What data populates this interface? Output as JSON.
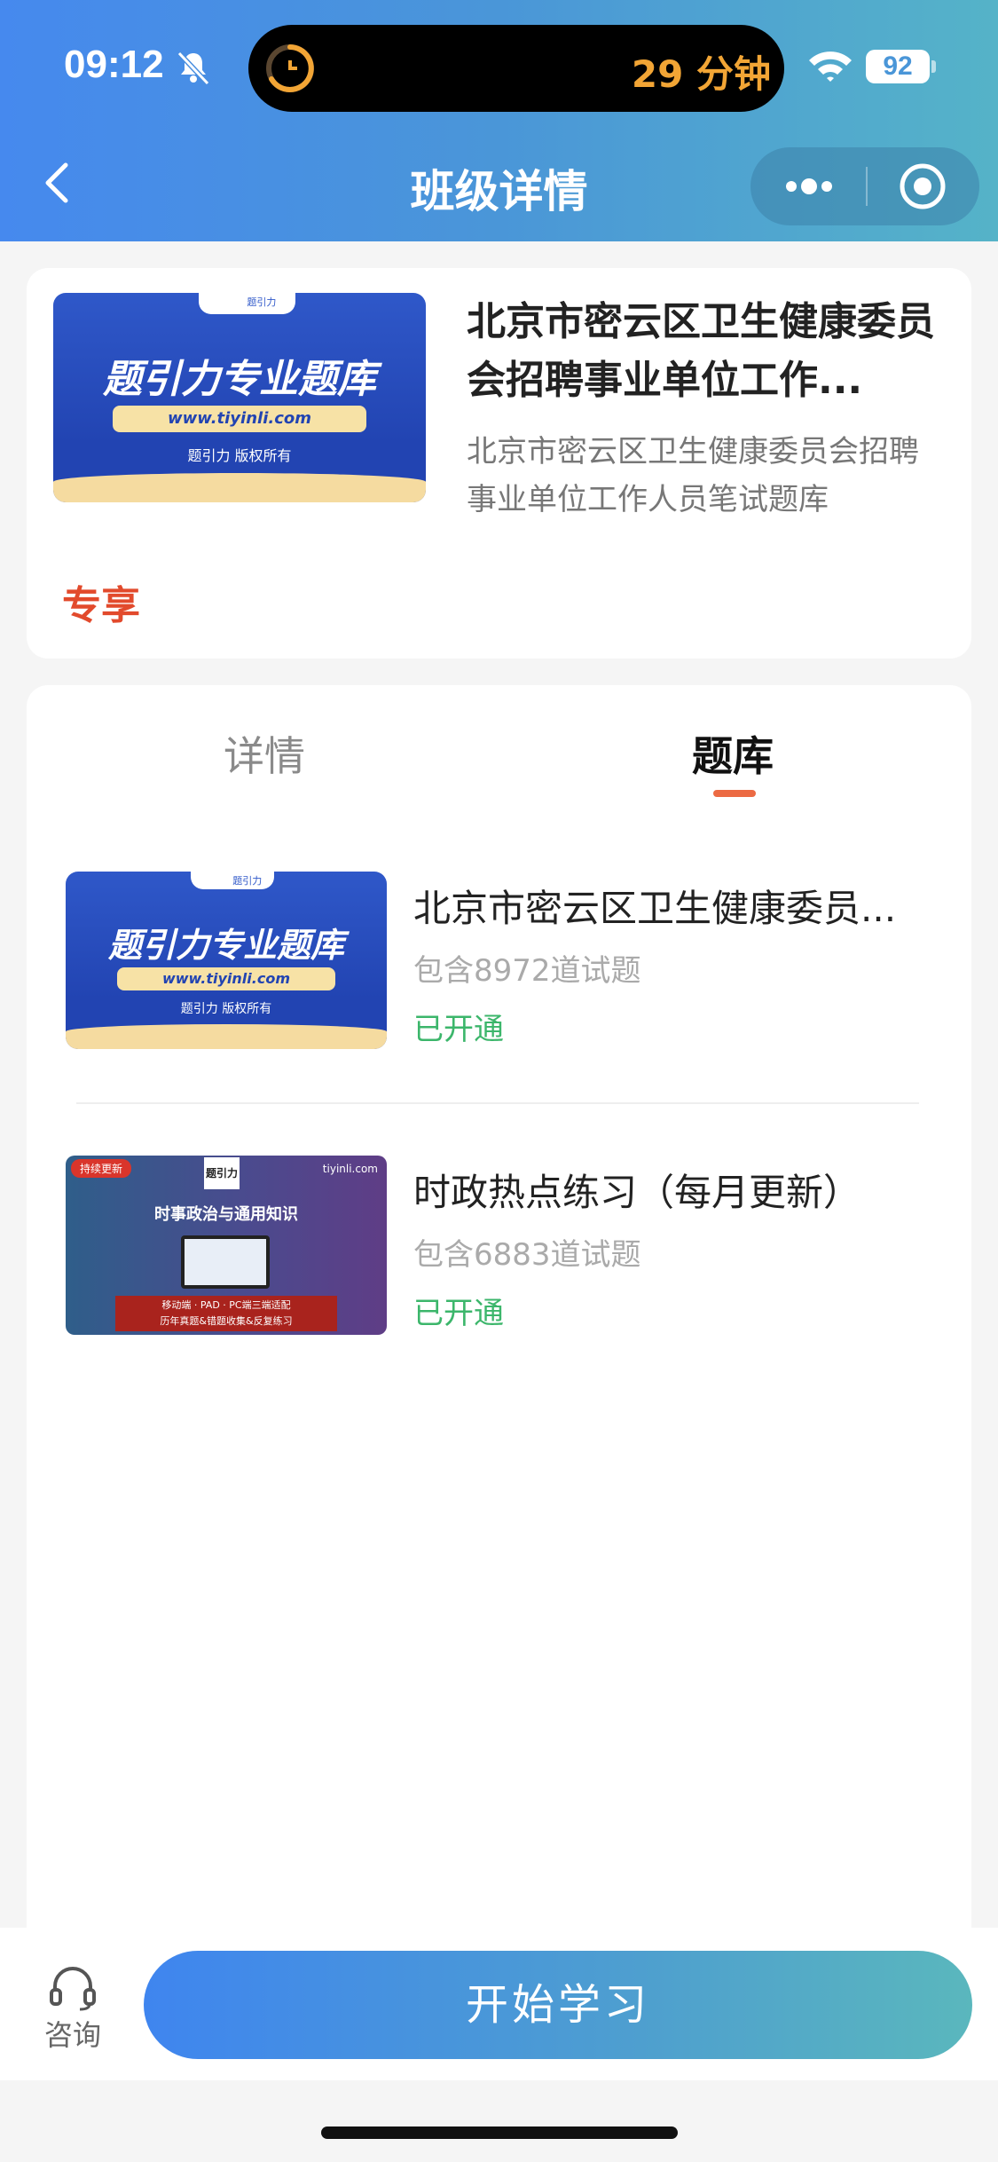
{
  "status_bar": {
    "time": "09:12",
    "island_text": "29 分钟",
    "battery": "92"
  },
  "nav": {
    "title": "班级详情"
  },
  "course": {
    "title": "北京市密云区卫生健康委员会招聘事业单位工作...",
    "description": "北京市密云区卫生健康委员会招聘事业单位工作人员笔试题库",
    "badge": "专享",
    "banner": {
      "notch": "题引力",
      "title": "题引力专业题库",
      "url": "www.tiyinli.com",
      "copyright": "题引力 版权所有"
    }
  },
  "tabs": [
    {
      "label": "详情",
      "active": false
    },
    {
      "label": "题库",
      "active": true
    }
  ],
  "question_banks": [
    {
      "title": "北京市密云区卫生健康委员...",
      "count": "包含8972道试题",
      "status": "已开通",
      "banner": {
        "notch": "题引力",
        "title": "题引力专业题库",
        "url": "www.tiyinli.com",
        "copyright": "题引力 版权所有"
      }
    },
    {
      "title": "时政热点练习（每月更新）",
      "count": "包含6883道试题",
      "status": "已开通",
      "banner": {
        "tag": "持续更新",
        "logo": "题引力",
        "site": "tiyinli.com",
        "title": "时事政治与通用知识",
        "ribbon_line1": "移动端 · PAD · PC端三端适配",
        "ribbon_line2": "历年真题&错题收集&反复练习"
      }
    }
  ],
  "bottom_bar": {
    "consult_label": "咨询",
    "start_label": "开始学习"
  },
  "colors": {
    "accent": "#4689ee",
    "exclusive": "#e24a2c",
    "opened": "#3cb66b",
    "tab_indicator": "#ec6a43"
  }
}
